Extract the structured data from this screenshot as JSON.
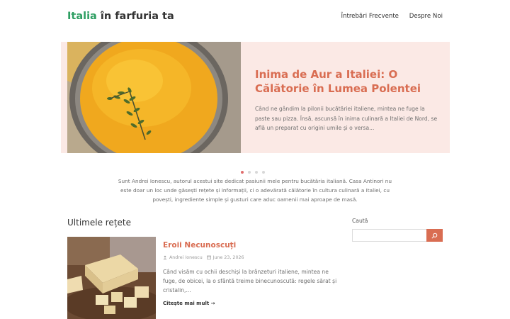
{
  "header": {
    "logo_accent": "Italia",
    "logo_rest": " în farfuria ta",
    "nav": [
      "Întrebări Frecvente",
      "Despre Noi"
    ]
  },
  "hero": {
    "title": "Inima de Aur a Italiei: O Călătorie în Lumea Polentei",
    "excerpt": "Când ne gândim la pilonii bucătăriei italiene, mintea ne fuge la paste sau pizza. Însă, ascunsă în inima culinară a Italiei de Nord, se află un preparat cu origini umile și o versa...",
    "image_icon": "polenta-image"
  },
  "slider": {
    "dot_count": 4,
    "active_index": 0
  },
  "intro": "Sunt Andrei Ionescu, autorul acestui site dedicat pasiunii mele pentru bucătăria italiană. Casa Antinori nu este doar un loc unde găsești rețete și informații, ci o adevărată călătorie în cultura culinară a Italiei, cu povești, ingrediente simple și gusturi care aduc oamenii mai aproape de masă.",
  "latest": {
    "title": "Ultimele rețete",
    "post": {
      "title": "Eroii Necunoscuți",
      "author": "Andrei Ionescu",
      "date": "June 23, 2026",
      "excerpt": "Când visăm cu ochii deschiși la brânzeturi italiene, mintea ne fuge, de obicei, la o sfântă treime binecunoscută: regele sărat și cristalin,...",
      "read_more": "Citește mai mult",
      "image_icon": "cheese-image"
    }
  },
  "sidebar": {
    "search_label": "Caută",
    "search_value": "",
    "search_placeholder": ""
  },
  "colors": {
    "accent": "#d96d52",
    "green": "#2e9e62",
    "hero_bg": "#fbe9e5"
  }
}
